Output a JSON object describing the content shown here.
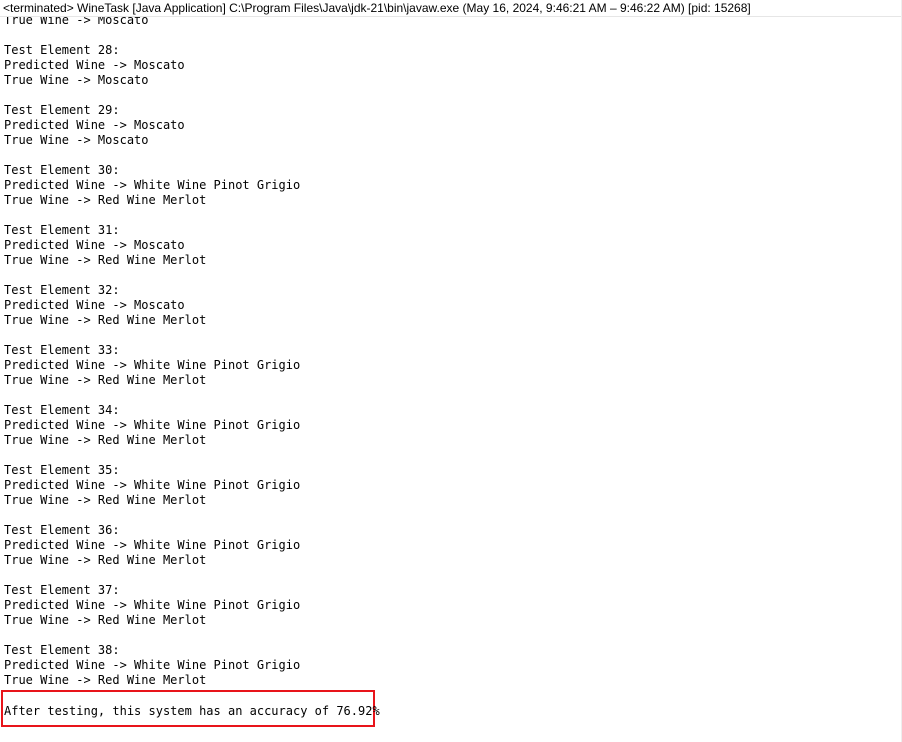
{
  "console": {
    "header": "<terminated> WineTask [Java Application] C:\\Program Files\\Java\\jdk-21\\bin\\javaw.exe  (May 16, 2024, 9:46:21 AM – 9:46:22 AM) [pid: 15268]",
    "lines": [
      "True Wine -> Moscato",
      "",
      "Test Element 28:",
      "Predicted Wine -> Moscato",
      "True Wine -> Moscato",
      "",
      "Test Element 29:",
      "Predicted Wine -> Moscato",
      "True Wine -> Moscato",
      "",
      "Test Element 30:",
      "Predicted Wine -> White Wine Pinot Grigio",
      "True Wine -> Red Wine Merlot",
      "",
      "Test Element 31:",
      "Predicted Wine -> Moscato",
      "True Wine -> Red Wine Merlot",
      "",
      "Test Element 32:",
      "Predicted Wine -> Moscato",
      "True Wine -> Red Wine Merlot",
      "",
      "Test Element 33:",
      "Predicted Wine -> White Wine Pinot Grigio",
      "True Wine -> Red Wine Merlot",
      "",
      "Test Element 34:",
      "Predicted Wine -> White Wine Pinot Grigio",
      "True Wine -> Red Wine Merlot",
      "",
      "Test Element 35:",
      "Predicted Wine -> White Wine Pinot Grigio",
      "True Wine -> Red Wine Merlot",
      "",
      "Test Element 36:",
      "Predicted Wine -> White Wine Pinot Grigio",
      "True Wine -> Red Wine Merlot",
      "",
      "Test Element 37:",
      "Predicted Wine -> White Wine Pinot Grigio",
      "True Wine -> Red Wine Merlot",
      "",
      "Test Element 38:",
      "Predicted Wine -> White Wine Pinot Grigio",
      "True Wine -> Red Wine Merlot"
    ],
    "accuracy_line": "After testing, this system has an accuracy of 76.92%"
  },
  "colors": {
    "highlight_border": "#e8141a",
    "background": "#ffffff",
    "text": "#000000"
  }
}
